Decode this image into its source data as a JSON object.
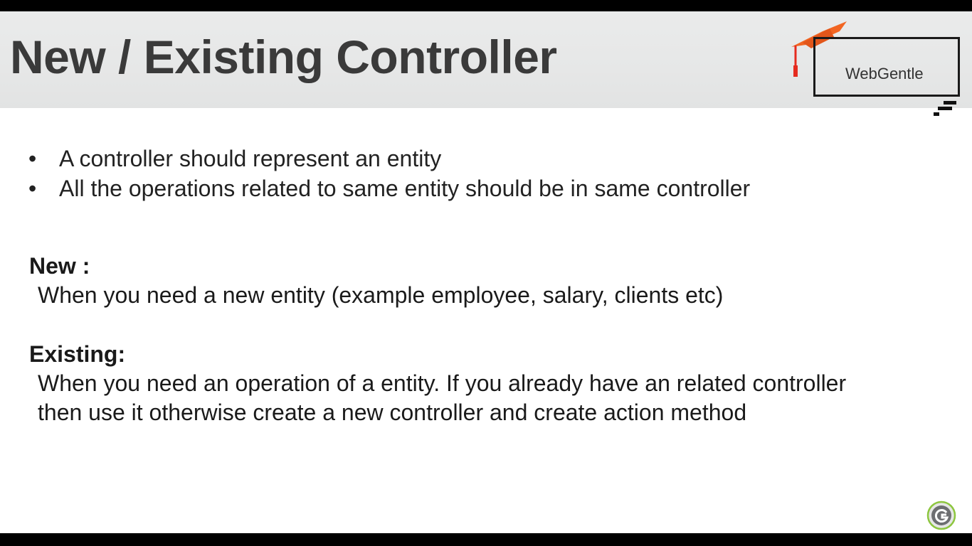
{
  "slide": {
    "title": "New / Existing Controller",
    "brand": {
      "name": "WebGentle",
      "logo_icon": "graduation-cap-icon",
      "accent_color": "#f26522"
    },
    "bullets": [
      "A controller should represent an entity",
      "All the operations related to same entity should be in same controller"
    ],
    "sections": [
      {
        "label": "New :",
        "body": "When you need a new entity (example employee, salary, clients etc)"
      },
      {
        "label": "Existing:",
        "body": "When you need an operation of a entity. If you already have an related controller then use it otherwise create a new controller and create action method"
      }
    ],
    "footer_icon": "channel-logo-icon"
  }
}
